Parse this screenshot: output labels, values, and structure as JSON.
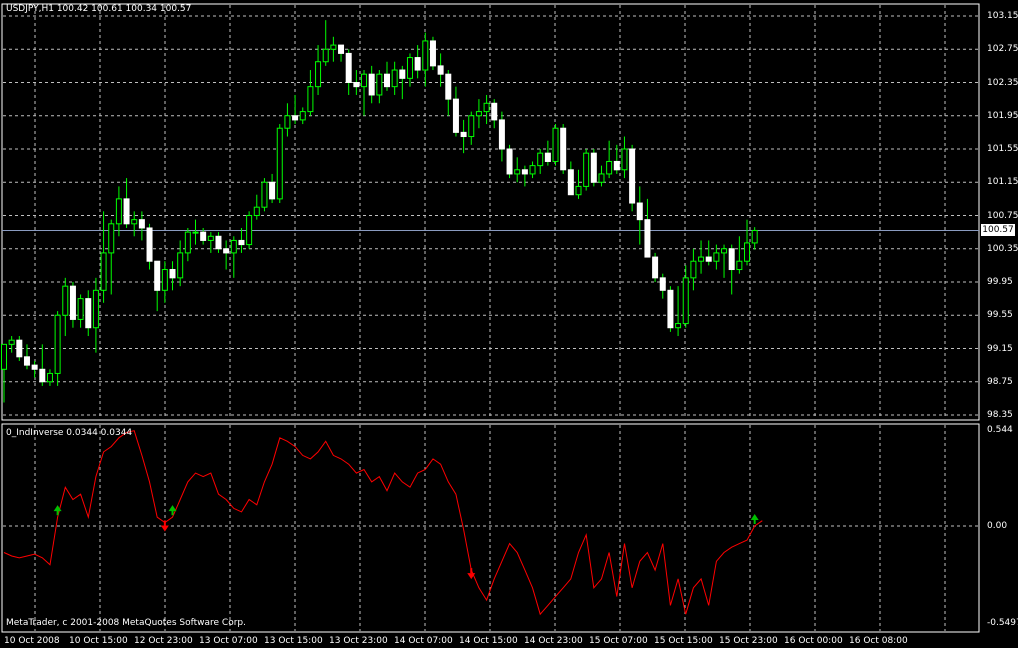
{
  "main_chart": {
    "title": "USDJPY,H1  100.42 100.61 100.34 100.57",
    "current_price_label": "100.57",
    "y_tick_labels": [
      "103.15",
      "102.75",
      "102.35",
      "101.95",
      "101.55",
      "101.15",
      "100.75",
      "100.35",
      "99.95",
      "99.55",
      "99.15",
      "98.75",
      "98.35"
    ],
    "colors": {
      "background": "#000000",
      "grid": "#c0c0c0",
      "frame": "#ffffff",
      "bull_body": "#000000",
      "bull_outline": "#00ff00",
      "bear_body": "#ffffff",
      "wick": "#00ff00",
      "current_price_line": "#8a9bc0"
    }
  },
  "indicator": {
    "title": "0_IndInverse 0.0344 0.0344",
    "y_tick_labels": [
      "0.544",
      "0.00",
      "-0.5497"
    ],
    "line_color": "#ff0000",
    "up_arrow_color": "#00c000",
    "down_arrow_color": "#ff0000"
  },
  "x_tick_labels": [
    "10 Oct 2008",
    "10 Oct 15:00",
    "12 Oct 23:00",
    "13 Oct 07:00",
    "13 Oct 15:00",
    "13 Oct 23:00",
    "14 Oct 07:00",
    "14 Oct 15:00",
    "14 Oct 23:00",
    "15 Oct 07:00",
    "15 Oct 15:00",
    "15 Oct 23:00",
    "16 Oct 00:00",
    "16 Oct 08:00"
  ],
  "copyright": "MetaTrader, c 2001-2008 MetaQuotes Software Corp.",
  "chart_data": [
    {
      "type": "candlestick",
      "title": "USDJPY,H1  100.42 100.61 100.34 100.57",
      "symbol": "USDJPY",
      "timeframe": "H1",
      "last_bar": {
        "open": 100.42,
        "high": 100.61,
        "low": 100.34,
        "close": 100.57
      },
      "ylim": [
        98.3,
        103.2
      ],
      "grid": true,
      "x_tick_labels": [
        "10 Oct 2008",
        "10 Oct 15:00",
        "12 Oct 23:00",
        "13 Oct 07:00",
        "13 Oct 15:00",
        "13 Oct 23:00",
        "14 Oct 07:00",
        "14 Oct 15:00",
        "14 Oct 23:00",
        "15 Oct 07:00",
        "15 Oct 15:00",
        "15 Oct 23:00",
        "16 Oct 00:00",
        "16 Oct 08:00"
      ],
      "candles": [
        {
          "o": 98.9,
          "h": 99.2,
          "l": 98.5,
          "c": 99.2
        },
        {
          "o": 99.2,
          "h": 99.3,
          "l": 99.1,
          "c": 99.25
        },
        {
          "o": 99.25,
          "h": 99.3,
          "l": 99.0,
          "c": 99.05
        },
        {
          "o": 99.05,
          "h": 99.2,
          "l": 98.9,
          "c": 98.95
        },
        {
          "o": 98.95,
          "h": 99.0,
          "l": 98.8,
          "c": 98.9
        },
        {
          "o": 98.9,
          "h": 99.2,
          "l": 98.7,
          "c": 98.75
        },
        {
          "o": 98.75,
          "h": 98.9,
          "l": 98.7,
          "c": 98.85
        },
        {
          "o": 98.85,
          "h": 99.6,
          "l": 98.7,
          "c": 99.55
        },
        {
          "o": 99.55,
          "h": 100.0,
          "l": 99.3,
          "c": 99.9
        },
        {
          "o": 99.9,
          "h": 99.95,
          "l": 99.4,
          "c": 99.5
        },
        {
          "o": 99.5,
          "h": 99.8,
          "l": 99.4,
          "c": 99.75
        },
        {
          "o": 99.75,
          "h": 99.85,
          "l": 99.3,
          "c": 99.4
        },
        {
          "o": 99.4,
          "h": 100.0,
          "l": 99.1,
          "c": 99.85
        },
        {
          "o": 99.85,
          "h": 100.8,
          "l": 99.7,
          "c": 100.3
        },
        {
          "o": 100.3,
          "h": 100.7,
          "l": 99.8,
          "c": 100.65
        },
        {
          "o": 100.65,
          "h": 101.1,
          "l": 100.5,
          "c": 100.95
        },
        {
          "o": 100.95,
          "h": 101.2,
          "l": 100.6,
          "c": 100.65
        },
        {
          "o": 100.65,
          "h": 100.8,
          "l": 100.5,
          "c": 100.7
        },
        {
          "o": 100.7,
          "h": 100.8,
          "l": 100.45,
          "c": 100.6
        },
        {
          "o": 100.6,
          "h": 100.65,
          "l": 100.1,
          "c": 100.2
        },
        {
          "o": 100.2,
          "h": 100.2,
          "l": 99.6,
          "c": 99.85
        },
        {
          "o": 99.85,
          "h": 100.2,
          "l": 99.7,
          "c": 100.1
        },
        {
          "o": 100.1,
          "h": 100.2,
          "l": 99.85,
          "c": 100.0
        },
        {
          "o": 100.0,
          "h": 100.45,
          "l": 99.9,
          "c": 100.3
        },
        {
          "o": 100.3,
          "h": 100.6,
          "l": 100.2,
          "c": 100.55
        },
        {
          "o": 100.55,
          "h": 100.7,
          "l": 100.4,
          "c": 100.55
        },
        {
          "o": 100.55,
          "h": 100.6,
          "l": 100.4,
          "c": 100.45
        },
        {
          "o": 100.45,
          "h": 100.55,
          "l": 100.3,
          "c": 100.5
        },
        {
          "o": 100.5,
          "h": 100.55,
          "l": 100.3,
          "c": 100.35
        },
        {
          "o": 100.35,
          "h": 100.45,
          "l": 100.1,
          "c": 100.3
        },
        {
          "o": 100.3,
          "h": 100.5,
          "l": 100.0,
          "c": 100.45
        },
        {
          "o": 100.45,
          "h": 100.6,
          "l": 100.3,
          "c": 100.4
        },
        {
          "o": 100.4,
          "h": 100.8,
          "l": 100.35,
          "c": 100.75
        },
        {
          "o": 100.75,
          "h": 101.0,
          "l": 100.7,
          "c": 100.85
        },
        {
          "o": 100.85,
          "h": 101.2,
          "l": 100.8,
          "c": 101.15
        },
        {
          "o": 101.15,
          "h": 101.25,
          "l": 100.9,
          "c": 100.95
        },
        {
          "o": 100.95,
          "h": 101.85,
          "l": 100.9,
          "c": 101.8
        },
        {
          "o": 101.8,
          "h": 102.1,
          "l": 101.7,
          "c": 101.95
        },
        {
          "o": 101.95,
          "h": 102.2,
          "l": 101.85,
          "c": 101.9
        },
        {
          "o": 101.9,
          "h": 102.05,
          "l": 101.85,
          "c": 102.0
        },
        {
          "o": 102.0,
          "h": 102.5,
          "l": 101.95,
          "c": 102.3
        },
        {
          "o": 102.3,
          "h": 102.8,
          "l": 102.2,
          "c": 102.6
        },
        {
          "o": 102.6,
          "h": 103.1,
          "l": 102.55,
          "c": 102.75
        },
        {
          "o": 102.75,
          "h": 102.9,
          "l": 102.6,
          "c": 102.8
        },
        {
          "o": 102.8,
          "h": 102.8,
          "l": 102.6,
          "c": 102.7
        },
        {
          "o": 102.7,
          "h": 102.75,
          "l": 102.2,
          "c": 102.35
        },
        {
          "o": 102.35,
          "h": 102.5,
          "l": 102.2,
          "c": 102.3
        },
        {
          "o": 102.3,
          "h": 102.5,
          "l": 101.95,
          "c": 102.45
        },
        {
          "o": 102.45,
          "h": 102.55,
          "l": 102.1,
          "c": 102.2
        },
        {
          "o": 102.2,
          "h": 102.5,
          "l": 102.1,
          "c": 102.45
        },
        {
          "o": 102.45,
          "h": 102.6,
          "l": 102.25,
          "c": 102.3
        },
        {
          "o": 102.3,
          "h": 102.6,
          "l": 102.2,
          "c": 102.5
        },
        {
          "o": 102.5,
          "h": 102.55,
          "l": 102.15,
          "c": 102.4
        },
        {
          "o": 102.4,
          "h": 102.7,
          "l": 102.3,
          "c": 102.65
        },
        {
          "o": 102.65,
          "h": 102.8,
          "l": 102.4,
          "c": 102.5
        },
        {
          "o": 102.5,
          "h": 102.95,
          "l": 102.3,
          "c": 102.85
        },
        {
          "o": 102.85,
          "h": 102.9,
          "l": 102.5,
          "c": 102.55
        },
        {
          "o": 102.55,
          "h": 102.7,
          "l": 102.3,
          "c": 102.45
        },
        {
          "o": 102.45,
          "h": 102.5,
          "l": 101.95,
          "c": 102.15
        },
        {
          "o": 102.15,
          "h": 102.3,
          "l": 101.7,
          "c": 101.75
        },
        {
          "o": 101.75,
          "h": 101.9,
          "l": 101.5,
          "c": 101.7
        },
        {
          "o": 101.7,
          "h": 102.0,
          "l": 101.6,
          "c": 101.95
        },
        {
          "o": 101.95,
          "h": 102.15,
          "l": 101.8,
          "c": 102.0
        },
        {
          "o": 102.0,
          "h": 102.2,
          "l": 101.85,
          "c": 102.1
        },
        {
          "o": 102.1,
          "h": 102.15,
          "l": 101.8,
          "c": 101.9
        },
        {
          "o": 101.9,
          "h": 102.0,
          "l": 101.4,
          "c": 101.55
        },
        {
          "o": 101.55,
          "h": 101.6,
          "l": 101.2,
          "c": 101.25
        },
        {
          "o": 101.25,
          "h": 101.45,
          "l": 101.15,
          "c": 101.3
        },
        {
          "o": 101.3,
          "h": 101.35,
          "l": 101.1,
          "c": 101.25
        },
        {
          "o": 101.25,
          "h": 101.4,
          "l": 101.2,
          "c": 101.35
        },
        {
          "o": 101.35,
          "h": 101.55,
          "l": 101.25,
          "c": 101.5
        },
        {
          "o": 101.5,
          "h": 101.65,
          "l": 101.35,
          "c": 101.4
        },
        {
          "o": 101.4,
          "h": 101.85,
          "l": 101.35,
          "c": 101.8
        },
        {
          "o": 101.8,
          "h": 101.85,
          "l": 101.25,
          "c": 101.3
        },
        {
          "o": 101.3,
          "h": 101.4,
          "l": 101.0,
          "c": 101.0
        },
        {
          "o": 101.0,
          "h": 101.3,
          "l": 100.95,
          "c": 101.1
        },
        {
          "o": 101.1,
          "h": 101.55,
          "l": 101.05,
          "c": 101.5
        },
        {
          "o": 101.5,
          "h": 101.55,
          "l": 101.1,
          "c": 101.15
        },
        {
          "o": 101.15,
          "h": 101.35,
          "l": 101.1,
          "c": 101.25
        },
        {
          "o": 101.25,
          "h": 101.65,
          "l": 101.2,
          "c": 101.4
        },
        {
          "o": 101.4,
          "h": 101.6,
          "l": 101.25,
          "c": 101.3
        },
        {
          "o": 101.3,
          "h": 101.7,
          "l": 101.2,
          "c": 101.55
        },
        {
          "o": 101.55,
          "h": 101.6,
          "l": 100.8,
          "c": 100.9
        },
        {
          "o": 100.9,
          "h": 101.1,
          "l": 100.4,
          "c": 100.7
        },
        {
          "o": 100.7,
          "h": 100.95,
          "l": 100.3,
          "c": 100.25
        },
        {
          "o": 100.25,
          "h": 100.3,
          "l": 99.95,
          "c": 100.0
        },
        {
          "o": 100.0,
          "h": 100.05,
          "l": 99.75,
          "c": 99.85
        },
        {
          "o": 99.85,
          "h": 99.9,
          "l": 99.35,
          "c": 99.4
        },
        {
          "o": 99.4,
          "h": 99.9,
          "l": 99.3,
          "c": 99.45
        },
        {
          "o": 99.45,
          "h": 100.15,
          "l": 99.4,
          "c": 100.0
        },
        {
          "o": 100.0,
          "h": 100.35,
          "l": 99.85,
          "c": 100.2
        },
        {
          "o": 100.2,
          "h": 100.45,
          "l": 100.05,
          "c": 100.25
        },
        {
          "o": 100.25,
          "h": 100.45,
          "l": 100.15,
          "c": 100.2
        },
        {
          "o": 100.2,
          "h": 100.4,
          "l": 100.1,
          "c": 100.3
        },
        {
          "o": 100.3,
          "h": 100.4,
          "l": 100.0,
          "c": 100.35
        },
        {
          "o": 100.35,
          "h": 100.4,
          "l": 99.8,
          "c": 100.1
        },
        {
          "o": 100.1,
          "h": 100.5,
          "l": 100.05,
          "c": 100.2
        },
        {
          "o": 100.2,
          "h": 100.7,
          "l": 100.15,
          "c": 100.42
        },
        {
          "o": 100.42,
          "h": 100.61,
          "l": 100.34,
          "c": 100.57
        }
      ]
    },
    {
      "type": "line",
      "title": "0_IndInverse 0.0344 0.0344",
      "series": [
        {
          "name": "0_IndInverse",
          "values": [
            -0.15,
            -0.17,
            -0.18,
            -0.17,
            -0.16,
            -0.18,
            -0.22,
            0.05,
            0.22,
            0.15,
            0.18,
            0.05,
            0.28,
            0.42,
            0.45,
            0.5,
            0.53,
            0.54,
            0.4,
            0.25,
            0.05,
            0.02,
            0.05,
            0.15,
            0.25,
            0.3,
            0.28,
            0.3,
            0.18,
            0.15,
            0.1,
            0.08,
            0.15,
            0.12,
            0.25,
            0.35,
            0.5,
            0.48,
            0.45,
            0.4,
            0.38,
            0.42,
            0.48,
            0.4,
            0.38,
            0.35,
            0.3,
            0.32,
            0.25,
            0.28,
            0.2,
            0.3,
            0.25,
            0.22,
            0.3,
            0.32,
            0.38,
            0.35,
            0.25,
            0.18,
            -0.02,
            -0.25,
            -0.35,
            -0.42,
            -0.3,
            -0.2,
            -0.1,
            -0.15,
            -0.25,
            -0.35,
            -0.5,
            -0.45,
            -0.4,
            -0.35,
            -0.3,
            -0.15,
            -0.05,
            -0.35,
            -0.3,
            -0.15,
            -0.4,
            -0.1,
            -0.35,
            -0.2,
            -0.15,
            -0.25,
            -0.1,
            -0.45,
            -0.3,
            -0.5,
            -0.35,
            -0.3,
            -0.45,
            -0.2,
            -0.15,
            -0.12,
            -0.1,
            -0.08,
            0.0,
            0.03
          ]
        }
      ],
      "arrows": [
        {
          "index": 7,
          "direction": "up"
        },
        {
          "index": 21,
          "direction": "down"
        },
        {
          "index": 22,
          "direction": "up"
        },
        {
          "index": 61,
          "direction": "down"
        },
        {
          "index": 98,
          "direction": "up"
        }
      ],
      "ylim": [
        -0.5497,
        0.544
      ],
      "grid": true
    }
  ]
}
